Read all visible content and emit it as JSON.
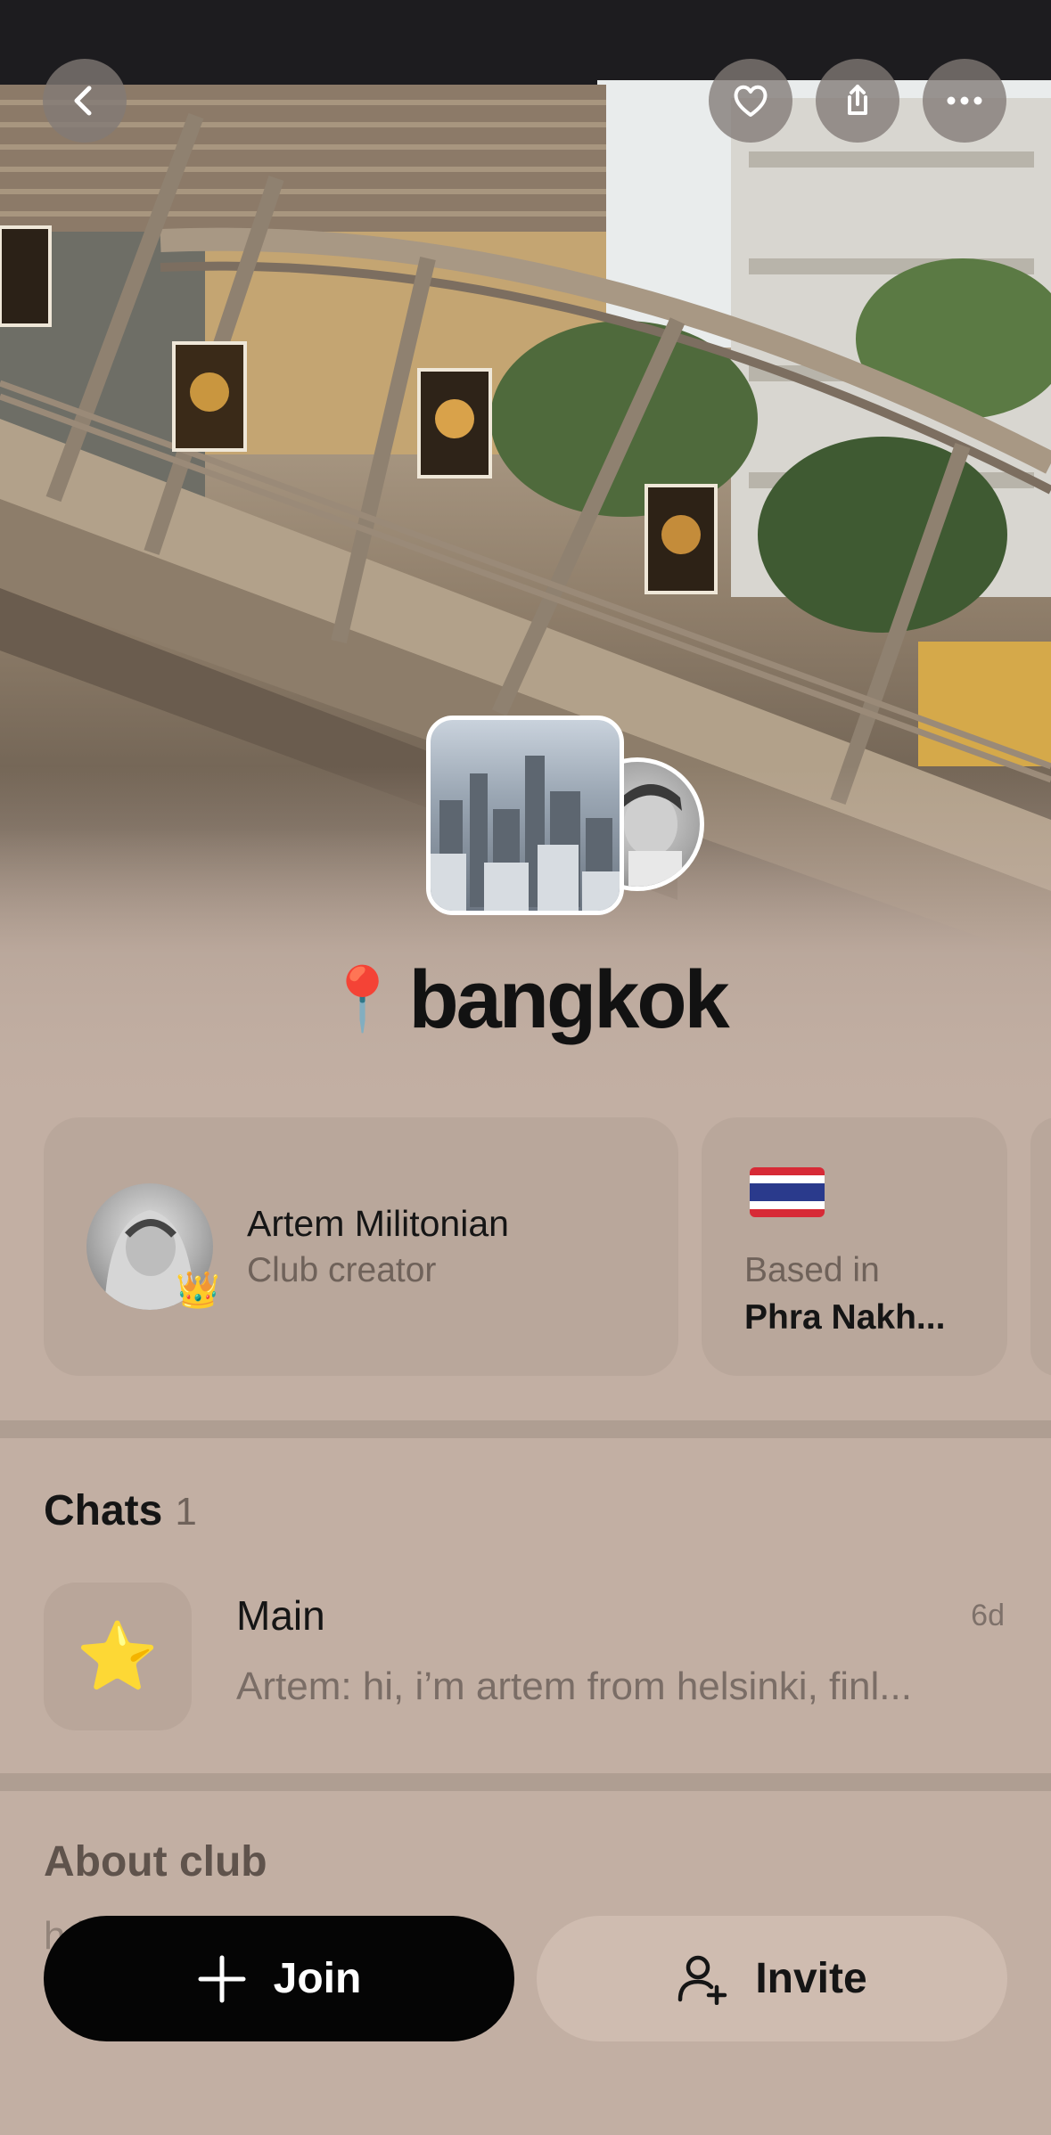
{
  "header": {
    "back_icon": "chevron-left-icon",
    "favorite_icon": "heart-icon",
    "share_icon": "share-icon",
    "more_icon": "more-horizontal-icon"
  },
  "club": {
    "title": "bangkok",
    "title_emoji": "📍"
  },
  "creator": {
    "name": "Artem Militonian",
    "role": "Club creator",
    "badge_emoji": "👑"
  },
  "location": {
    "label": "Based in",
    "value": "Phra Nakh...",
    "flag": "thailand-flag"
  },
  "chats": {
    "title": "Chats",
    "count": "1",
    "items": [
      {
        "emoji": "⭐",
        "name": "Main",
        "time": "6d",
        "preview": "Artem: hi, i’m artem from helsinki, finl..."
      }
    ]
  },
  "about": {
    "title": "About club",
    "peek_text": "h                                 ki"
  },
  "actions": {
    "join_label": "Join",
    "invite_label": "Invite"
  },
  "colors": {
    "background": "#c2afa3",
    "join_bg": "#050505",
    "invite_bg": "#cfbcb0"
  }
}
